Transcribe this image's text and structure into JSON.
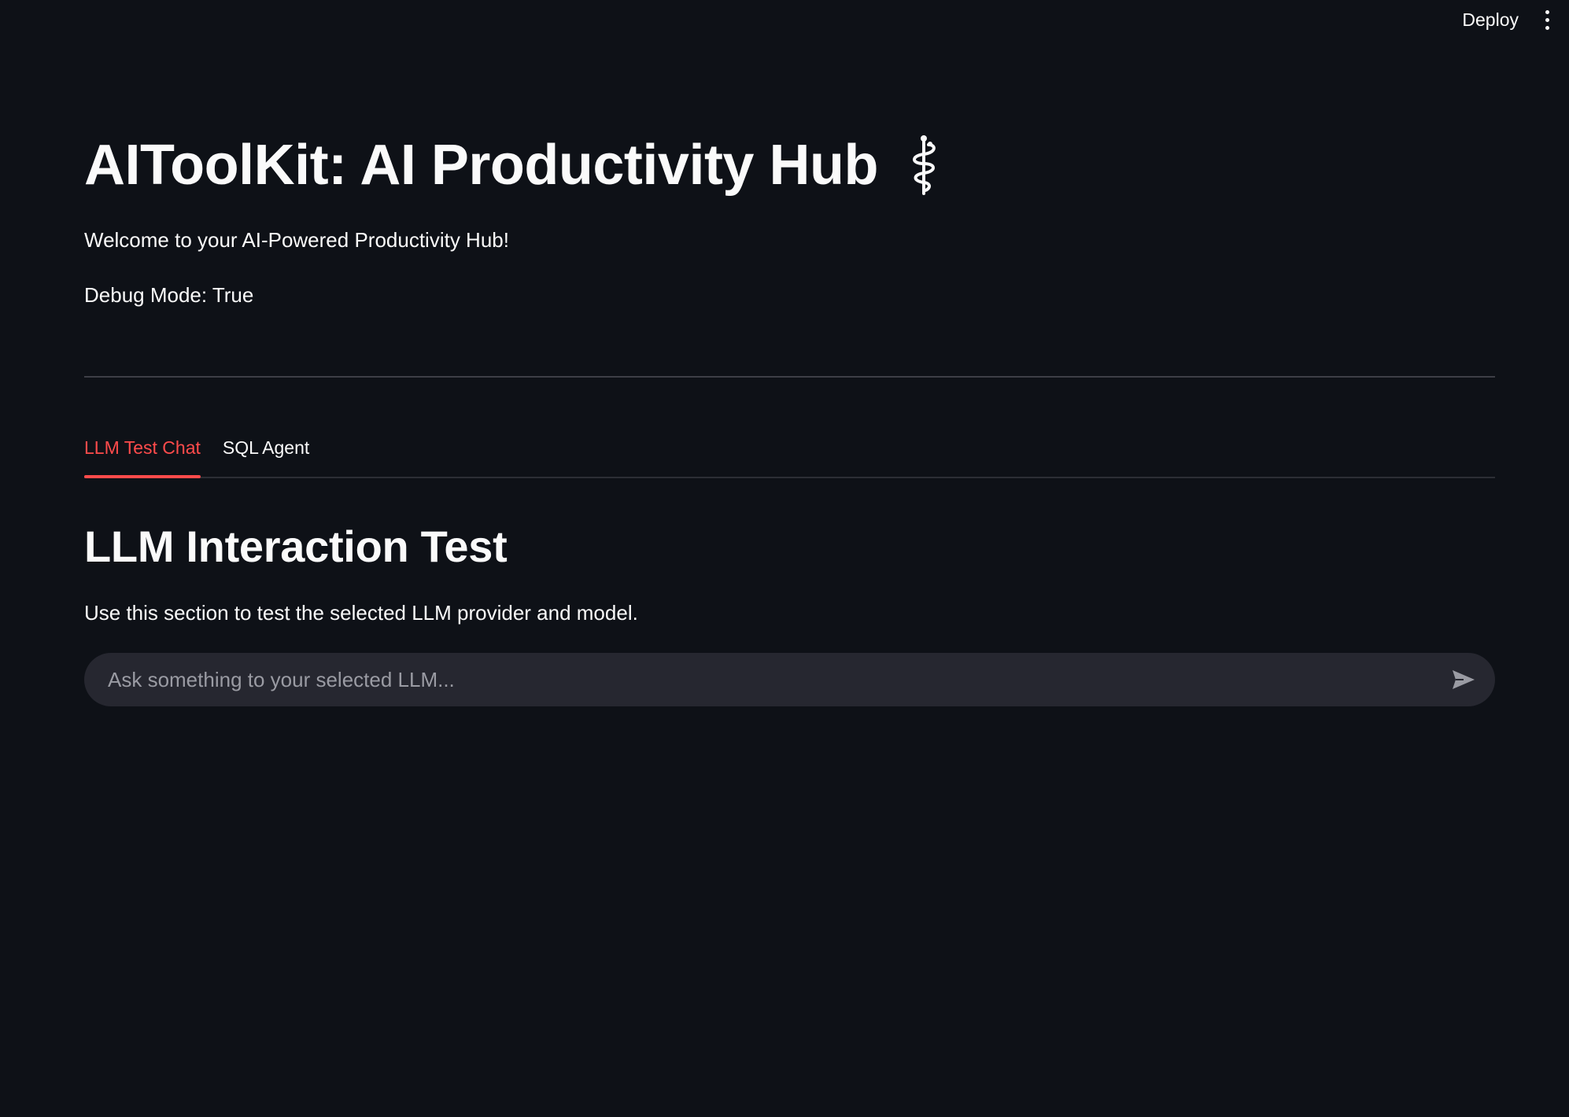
{
  "toolbar": {
    "deploy_label": "Deploy",
    "menu_icon": "kebab-menu-icon"
  },
  "header": {
    "title": "AIToolKit: AI Productivity Hub",
    "title_icon": "staff-of-aesculapius-icon",
    "welcome": "Welcome to your AI-Powered Productivity Hub!",
    "debug": "Debug Mode: True"
  },
  "tabs": [
    {
      "label": "LLM Test Chat",
      "active": true
    },
    {
      "label": "SQL Agent",
      "active": false
    }
  ],
  "main": {
    "section_title": "LLM Interaction Test",
    "section_desc": "Use this section to test the selected LLM provider and model.",
    "chat_placeholder": "Ask something to your selected LLM...",
    "send_icon": "send-icon"
  },
  "colors": {
    "background": "#0e1117",
    "accent": "#ff4b4b",
    "input_bg": "#262730",
    "text": "#fafafa"
  }
}
